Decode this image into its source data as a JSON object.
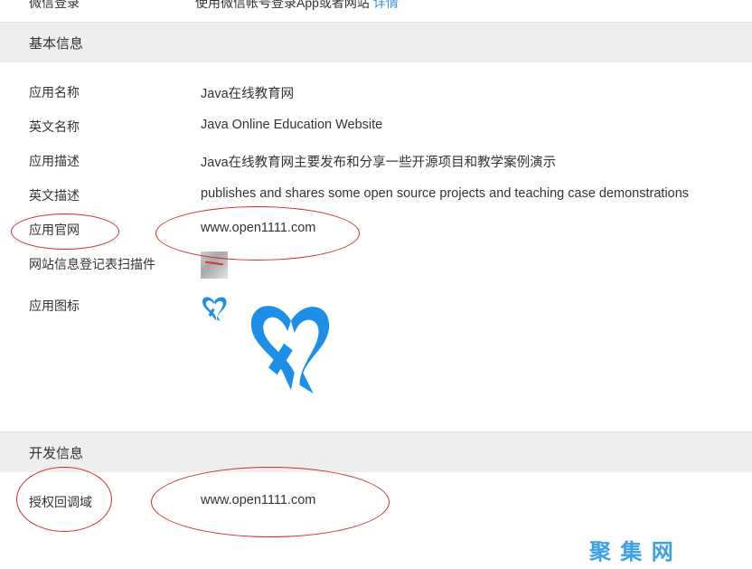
{
  "top_row": {
    "label": "微信登录",
    "value": "使用微信帐号登录App或者网站",
    "link": "详情"
  },
  "basic_section": {
    "title": "基本信息",
    "rows": [
      {
        "label": "应用名称",
        "value": "Java在线教育网"
      },
      {
        "label": "英文名称",
        "value": "Java Online Education Website"
      },
      {
        "label": "应用描述",
        "value": "Java在线教育网主要发布和分享一些开源项目和教学案例演示"
      },
      {
        "label": "英文描述",
        "value": "publishes and shares some open source projects and teaching case demonstrations"
      },
      {
        "label": "应用官网",
        "value": "www.open1111.com"
      },
      {
        "label": "网站信息登记表扫描件",
        "value": ""
      },
      {
        "label": "应用图标",
        "value": ""
      }
    ]
  },
  "dev_section": {
    "title": "开发信息",
    "rows": [
      {
        "label": "授权回调域",
        "value": "www.open1111.com"
      }
    ]
  },
  "watermark": "聚 集 网",
  "colors": {
    "section_bg": "#eeeeee",
    "link": "#3a8ee6",
    "annotation": "#d42a2a",
    "logo_blue": "#1e8fe6"
  }
}
